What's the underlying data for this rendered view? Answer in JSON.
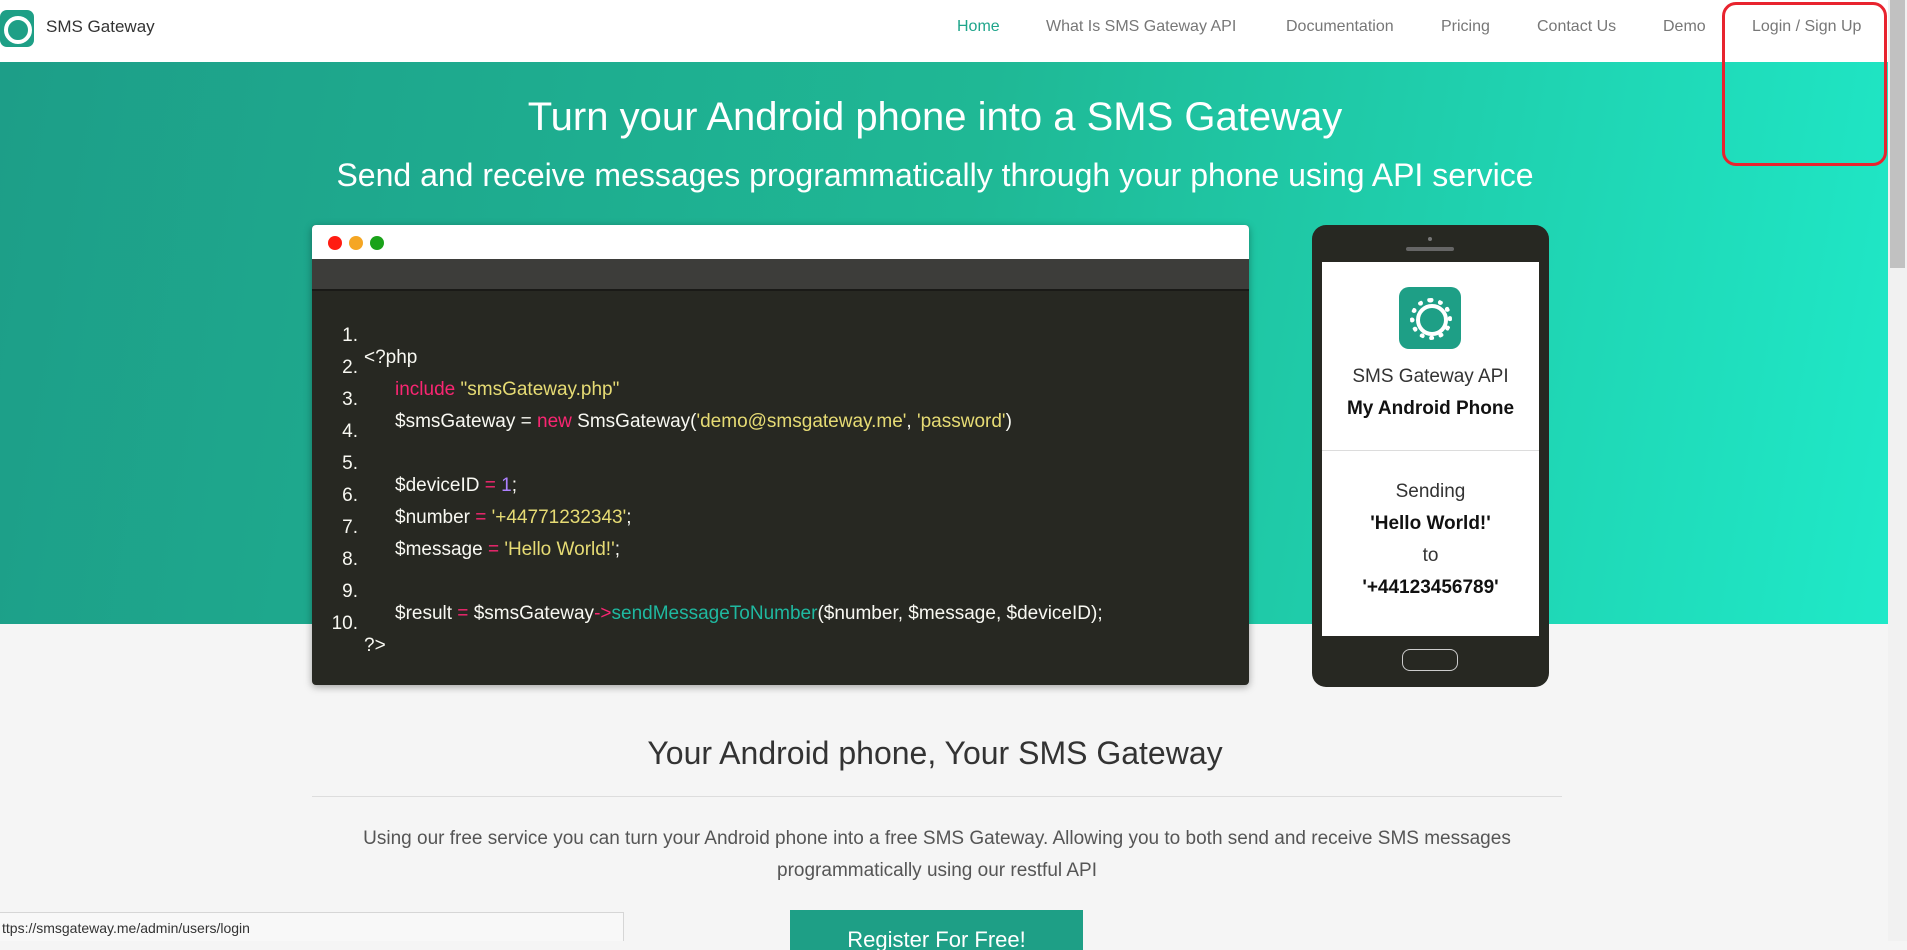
{
  "navbar": {
    "brand": "SMS Gateway",
    "items": [
      {
        "label": "Home",
        "active": true
      },
      {
        "label": "What Is SMS Gateway API"
      },
      {
        "label": "Documentation"
      },
      {
        "label": "Pricing"
      },
      {
        "label": "Contact Us"
      },
      {
        "label": "Demo"
      },
      {
        "label": "Login / Sign Up"
      }
    ]
  },
  "hero": {
    "title": "Turn your Android phone into a SMS Gateway",
    "subtitle": "Send and receive messages programmatically through your phone using API service"
  },
  "code": {
    "line_numbers": [
      "1.",
      "2.",
      "3.",
      "4.",
      "5.",
      "6.",
      "7.",
      "8.",
      "9.",
      "10."
    ],
    "php_open": "<?php",
    "php_close": "?>",
    "include_kw": "include",
    "include_file": "\"smsGateway.php\"",
    "gateway_var": "$smsGateway",
    "assign_eq": " = ",
    "new_kw": "new",
    "class_call": " SmsGateway(",
    "email_str": "'demo@smsgateway.me'",
    "comma": ", ",
    "password_str": "'password'",
    "close_paren": ")",
    "device_var": "$deviceID",
    "device_val": "1",
    "number_var": "$number",
    "number_val": "'+44771232343'",
    "message_var": "$message",
    "message_val": "'Hello World!'",
    "semicolon": ";",
    "result_var": "$result",
    "arrow": "->",
    "method": "sendMessageToNumber",
    "method_args": "($number, $message, $deviceID);"
  },
  "phone": {
    "app_name": "SMS Gateway API",
    "device_name": "My Android Phone",
    "status": "Sending",
    "message": "'Hello World!'",
    "to": "to",
    "recipient": "'+44123456789'"
  },
  "section": {
    "title": "Your Android phone, Your SMS Gateway",
    "description": "Using our free service you can turn your Android phone into a free SMS Gateway. Allowing you to both send and receive SMS messages programmatically using our restful API",
    "register_button": "Register For Free!"
  },
  "status_bar": {
    "url": "ttps://smsgateway.me/admin/users/login"
  },
  "colors": {
    "brand": "#1e9f86",
    "hero_start": "#1d9e88",
    "hero_end": "#1fe9c8",
    "annotation": "#e8232e"
  }
}
